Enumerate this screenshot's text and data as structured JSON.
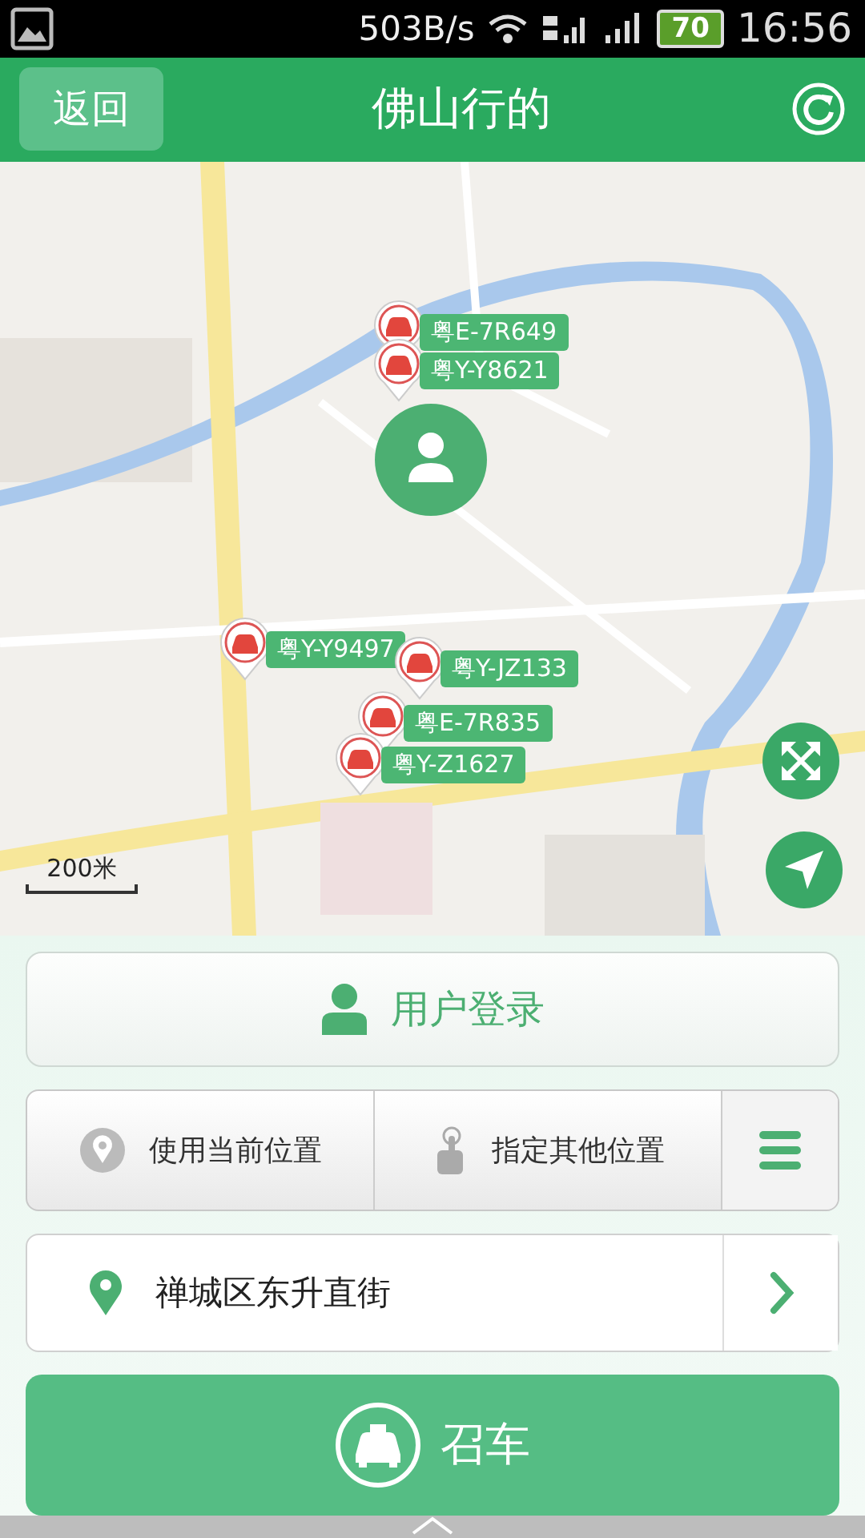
{
  "status_bar": {
    "speed": "503B/s",
    "battery": "70",
    "time": "16:56"
  },
  "header": {
    "back": "返回",
    "title": "佛山行的"
  },
  "map": {
    "kind": "picture",
    "scale": "200米",
    "cars": [
      {
        "plate": "粤E-7R649"
      },
      {
        "plate": "粤Y-Y8621"
      },
      {
        "plate": "粤Y-Y9497"
      },
      {
        "plate": "粤Y-JZ133"
      },
      {
        "plate": "粤E-7R835"
      },
      {
        "plate": "粤Y-Z1627"
      }
    ]
  },
  "login": {
    "label": "用户登录"
  },
  "location_options": [
    {
      "label": "使用当前位置",
      "kind": "current"
    },
    {
      "label": "指定其他位置",
      "kind": "other"
    }
  ],
  "address": {
    "value": "禅城区东升直街"
  },
  "call_button": {
    "label": "召车"
  }
}
